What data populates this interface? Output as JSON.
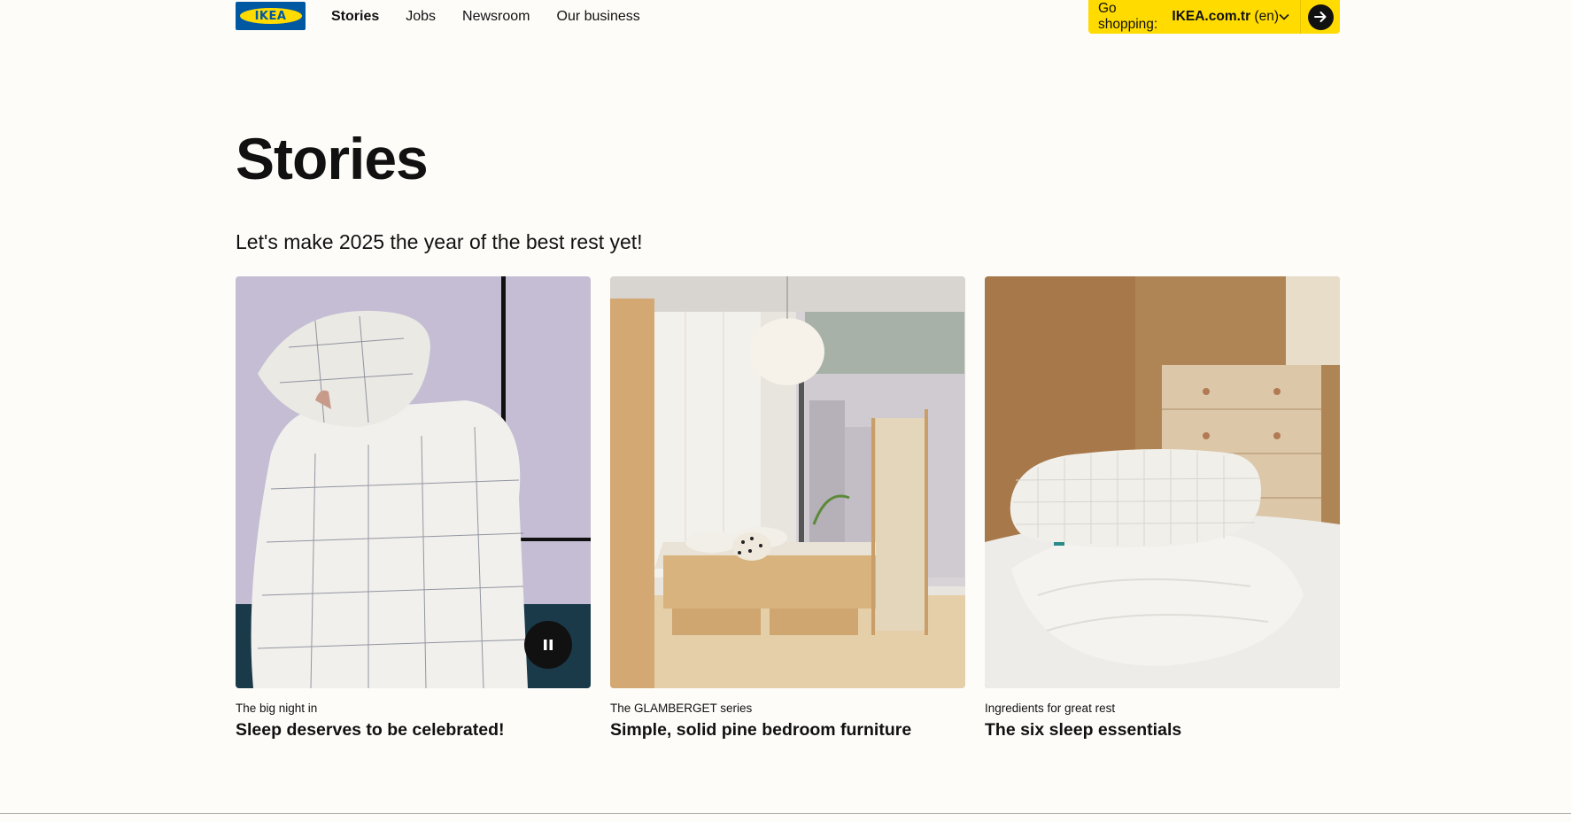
{
  "header": {
    "logo_text": "IKEA",
    "nav": [
      {
        "label": "Stories",
        "active": true
      },
      {
        "label": "Jobs",
        "active": false
      },
      {
        "label": "Newsroom",
        "active": false
      },
      {
        "label": "Our business",
        "active": false
      }
    ],
    "shop": {
      "prefix": "Go shopping:",
      "site": "IKEA.com.tr",
      "lang": "(en)",
      "chevron_icon": "chevron-down-icon",
      "go_icon": "arrow-right-icon"
    }
  },
  "page": {
    "title": "Stories",
    "subtitle": "Let's make 2025 the year of the best rest yet!"
  },
  "cards": [
    {
      "eyebrow": "The big night in",
      "title": "Sleep deserves to be celebrated!",
      "media": "video",
      "control_icon": "pause-icon"
    },
    {
      "eyebrow": "The GLAMBERGET series",
      "title": "Simple, solid pine bedroom furniture",
      "media": "image"
    },
    {
      "eyebrow": "Ingredients for great rest",
      "title": "The six sleep essentials",
      "media": "image"
    }
  ],
  "colors": {
    "background": "#fdfcf9",
    "ikea_blue": "#0058a3",
    "ikea_yellow": "#ffdb00",
    "text": "#111111"
  }
}
